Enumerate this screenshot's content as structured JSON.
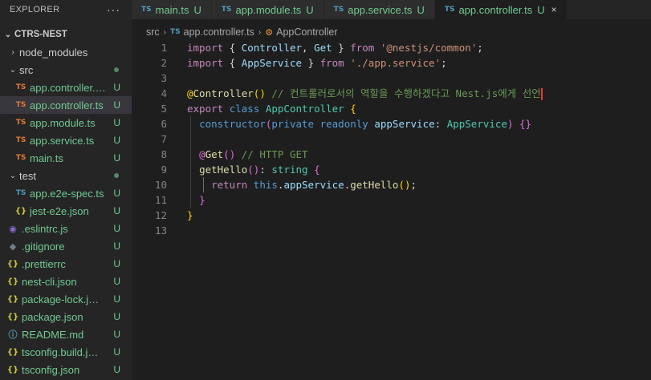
{
  "sidebar": {
    "title": "EXPLORER",
    "more": "···",
    "project": "CTRS-NEST",
    "items": [
      {
        "label": "node_modules",
        "kind": "folder",
        "chev": "›",
        "indent": 1,
        "status": ""
      },
      {
        "label": "src",
        "kind": "folder",
        "chev": "⌄",
        "indent": 1,
        "status": "dot"
      },
      {
        "label": "app.controller.spec.ts",
        "kind": "ts",
        "indent": 2,
        "status": "U"
      },
      {
        "label": "app.controller.ts",
        "kind": "ts",
        "indent": 2,
        "status": "U",
        "selected": true
      },
      {
        "label": "app.module.ts",
        "kind": "ts",
        "indent": 2,
        "status": "U"
      },
      {
        "label": "app.service.ts",
        "kind": "ts",
        "indent": 2,
        "status": "U"
      },
      {
        "label": "main.ts",
        "kind": "ts",
        "indent": 2,
        "status": "U"
      },
      {
        "label": "test",
        "kind": "folder",
        "chev": "⌄",
        "indent": 1,
        "status": "dot"
      },
      {
        "label": "app.e2e-spec.ts",
        "kind": "ts-blue",
        "indent": 2,
        "status": "U"
      },
      {
        "label": "jest-e2e.json",
        "kind": "json",
        "indent": 2,
        "status": "U"
      },
      {
        "label": ".eslintrc.js",
        "kind": "eslint",
        "indent": 1,
        "status": "U"
      },
      {
        "label": ".gitignore",
        "kind": "git",
        "indent": 1,
        "status": "U"
      },
      {
        "label": ".prettierrc",
        "kind": "json",
        "indent": 1,
        "status": "U"
      },
      {
        "label": "nest-cli.json",
        "kind": "json",
        "indent": 1,
        "status": "U"
      },
      {
        "label": "package-lock.json",
        "kind": "json",
        "indent": 1,
        "status": "U"
      },
      {
        "label": "package.json",
        "kind": "json",
        "indent": 1,
        "status": "U"
      },
      {
        "label": "README.md",
        "kind": "info",
        "indent": 1,
        "status": "U"
      },
      {
        "label": "tsconfig.build.json",
        "kind": "json",
        "indent": 1,
        "status": "U"
      },
      {
        "label": "tsconfig.json",
        "kind": "json",
        "indent": 1,
        "status": "U"
      }
    ]
  },
  "tabs": [
    {
      "label": "main.ts",
      "status": "U",
      "active": false
    },
    {
      "label": "app.module.ts",
      "status": "U",
      "active": false
    },
    {
      "label": "app.service.ts",
      "status": "U",
      "active": false
    },
    {
      "label": "app.controller.ts",
      "status": "U",
      "active": true
    }
  ],
  "tab_icon_text": "TS",
  "close_glyph": "×",
  "breadcrumb": {
    "folder": "src",
    "file": "app.controller.ts",
    "symbol": "AppController"
  },
  "code_lines": [
    [
      [
        "k",
        "import"
      ],
      [
        "p",
        " { "
      ],
      [
        "v",
        "Controller"
      ],
      [
        "p",
        ", "
      ],
      [
        "v",
        "Get"
      ],
      [
        "p",
        " } "
      ],
      [
        "k",
        "from"
      ],
      [
        "p",
        " "
      ],
      [
        "s",
        "'@nestjs/common'"
      ],
      [
        "p",
        ";"
      ]
    ],
    [
      [
        "k",
        "import"
      ],
      [
        "p",
        " { "
      ],
      [
        "v",
        "AppService"
      ],
      [
        "p",
        " } "
      ],
      [
        "k",
        "from"
      ],
      [
        "p",
        " "
      ],
      [
        "s",
        "'./app.service'"
      ],
      [
        "p",
        ";"
      ]
    ],
    [],
    [
      [
        "y",
        "@"
      ],
      [
        "f",
        "Controller"
      ],
      [
        "y",
        "()"
      ],
      [
        "p",
        " "
      ],
      [
        "c",
        "// 컨트롤러로서의 역할을 수행하겠다고 Nest.js에게 선언"
      ]
    ],
    [
      [
        "k",
        "export"
      ],
      [
        "p",
        " "
      ],
      [
        "kb",
        "class"
      ],
      [
        "p",
        " "
      ],
      [
        "t",
        "AppController"
      ],
      [
        "p",
        " "
      ],
      [
        "y",
        "{"
      ]
    ],
    [
      [
        "p",
        "  "
      ],
      [
        "kb",
        "constructor"
      ],
      [
        "pk",
        "("
      ],
      [
        "kb",
        "private"
      ],
      [
        "p",
        " "
      ],
      [
        "kb",
        "readonly"
      ],
      [
        "p",
        " "
      ],
      [
        "v",
        "appService"
      ],
      [
        "p",
        ": "
      ],
      [
        "t",
        "AppService"
      ],
      [
        "pk",
        ")"
      ],
      [
        "p",
        " "
      ],
      [
        "pk",
        "{}"
      ]
    ],
    [],
    [
      [
        "p",
        "  "
      ],
      [
        "pk",
        "@"
      ],
      [
        "f",
        "Get"
      ],
      [
        "pk",
        "()"
      ],
      [
        "p",
        " "
      ],
      [
        "c",
        "// HTTP GET"
      ]
    ],
    [
      [
        "p",
        "  "
      ],
      [
        "f",
        "getHello"
      ],
      [
        "pk",
        "()"
      ],
      [
        "p",
        ": "
      ],
      [
        "t",
        "string"
      ],
      [
        "p",
        " "
      ],
      [
        "pk",
        "{"
      ]
    ],
    [
      [
        "p",
        "    "
      ],
      [
        "k",
        "return"
      ],
      [
        "p",
        " "
      ],
      [
        "kb",
        "this"
      ],
      [
        "p",
        "."
      ],
      [
        "v",
        "appService"
      ],
      [
        "p",
        "."
      ],
      [
        "f",
        "getHello"
      ],
      [
        "y",
        "()"
      ],
      [
        "p",
        ";"
      ]
    ],
    [
      [
        "p",
        "  "
      ],
      [
        "pk",
        "}"
      ]
    ],
    [
      [
        "y",
        "}"
      ]
    ],
    []
  ]
}
